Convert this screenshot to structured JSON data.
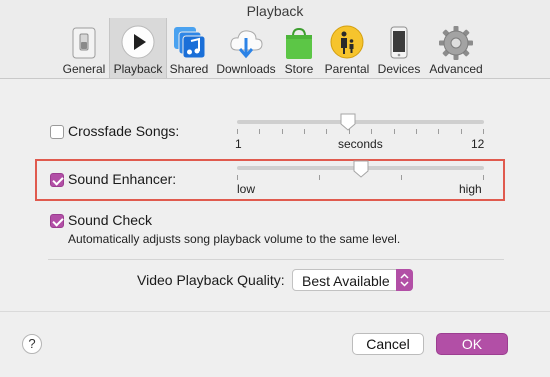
{
  "window": {
    "title": "Playback"
  },
  "toolbar": {
    "tabs": [
      {
        "label": "General",
        "icon": "general-switch-icon"
      },
      {
        "label": "Playback",
        "icon": "play-icon",
        "selected": true
      },
      {
        "label": "Shared",
        "icon": "shared-music-icon"
      },
      {
        "label": "Downloads",
        "icon": "cloud-download-icon"
      },
      {
        "label": "Store",
        "icon": "store-bag-icon"
      },
      {
        "label": "Parental",
        "icon": "parental-icon"
      },
      {
        "label": "Devices",
        "icon": "device-phone-icon"
      },
      {
        "label": "Advanced",
        "icon": "gear-icon"
      }
    ]
  },
  "crossfade": {
    "label": "Crossfade Songs:",
    "checked": false,
    "slider_min_label": "1",
    "slider_unit_label": "seconds",
    "slider_max_label": "12",
    "value_fraction": 0.45
  },
  "sound_enhancer": {
    "label": "Sound Enhancer:",
    "checked": true,
    "slider_low_label": "low",
    "slider_high_label": "high",
    "value_fraction": 0.5
  },
  "sound_check": {
    "label": "Sound Check",
    "checked": true,
    "description": "Automatically adjusts song playback volume to the same level."
  },
  "video_quality": {
    "label": "Video Playback Quality:",
    "value": "Best Available"
  },
  "buttons": {
    "cancel": "Cancel",
    "ok": "OK",
    "help": "?"
  },
  "colors": {
    "accent": "#b24fa6",
    "highlight_border": "#e05a4e"
  }
}
